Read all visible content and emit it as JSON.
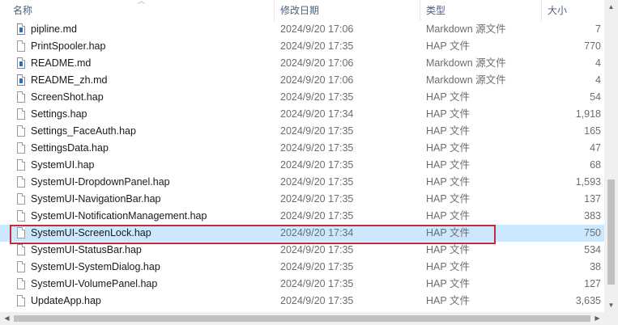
{
  "columns": {
    "name": "名称",
    "date": "修改日期",
    "type": "类型",
    "size": "大小"
  },
  "files": [
    {
      "name": "pipline.md",
      "date": "2024/9/20 17:06",
      "type": "Markdown 源文件",
      "size": "7",
      "icon": "markdown-file-icon"
    },
    {
      "name": "PrintSpooler.hap",
      "date": "2024/9/20 17:35",
      "type": "HAP 文件",
      "size": "770",
      "icon": "file-icon"
    },
    {
      "name": "README.md",
      "date": "2024/9/20 17:06",
      "type": "Markdown 源文件",
      "size": "4",
      "icon": "markdown-file-icon"
    },
    {
      "name": "README_zh.md",
      "date": "2024/9/20 17:06",
      "type": "Markdown 源文件",
      "size": "4",
      "icon": "markdown-file-icon"
    },
    {
      "name": "ScreenShot.hap",
      "date": "2024/9/20 17:35",
      "type": "HAP 文件",
      "size": "54",
      "icon": "file-icon"
    },
    {
      "name": "Settings.hap",
      "date": "2024/9/20 17:34",
      "type": "HAP 文件",
      "size": "1,918",
      "icon": "file-icon"
    },
    {
      "name": "Settings_FaceAuth.hap",
      "date": "2024/9/20 17:35",
      "type": "HAP 文件",
      "size": "165",
      "icon": "file-icon"
    },
    {
      "name": "SettingsData.hap",
      "date": "2024/9/20 17:35",
      "type": "HAP 文件",
      "size": "47",
      "icon": "file-icon"
    },
    {
      "name": "SystemUI.hap",
      "date": "2024/9/20 17:35",
      "type": "HAP 文件",
      "size": "68",
      "icon": "file-icon"
    },
    {
      "name": "SystemUI-DropdownPanel.hap",
      "date": "2024/9/20 17:35",
      "type": "HAP 文件",
      "size": "1,593",
      "icon": "file-icon"
    },
    {
      "name": "SystemUI-NavigationBar.hap",
      "date": "2024/9/20 17:35",
      "type": "HAP 文件",
      "size": "137",
      "icon": "file-icon"
    },
    {
      "name": "SystemUI-NotificationManagement.hap",
      "date": "2024/9/20 17:35",
      "type": "HAP 文件",
      "size": "383",
      "icon": "file-icon"
    },
    {
      "name": "SystemUI-ScreenLock.hap",
      "date": "2024/9/20 17:34",
      "type": "HAP 文件",
      "size": "750",
      "icon": "file-icon",
      "selected": true
    },
    {
      "name": "SystemUI-StatusBar.hap",
      "date": "2024/9/20 17:35",
      "type": "HAP 文件",
      "size": "534",
      "icon": "file-icon"
    },
    {
      "name": "SystemUI-SystemDialog.hap",
      "date": "2024/9/20 17:35",
      "type": "HAP 文件",
      "size": "38",
      "icon": "file-icon"
    },
    {
      "name": "SystemUI-VolumePanel.hap",
      "date": "2024/9/20 17:35",
      "type": "HAP 文件",
      "size": "127",
      "icon": "file-icon"
    },
    {
      "name": "UpdateApp.hap",
      "date": "2024/9/20 17:35",
      "type": "HAP 文件",
      "size": "3,635",
      "icon": "file-icon"
    }
  ],
  "colors": {
    "selection": "#cce8ff",
    "highlight_border": "#c8283c",
    "header_text": "#4c607a"
  }
}
